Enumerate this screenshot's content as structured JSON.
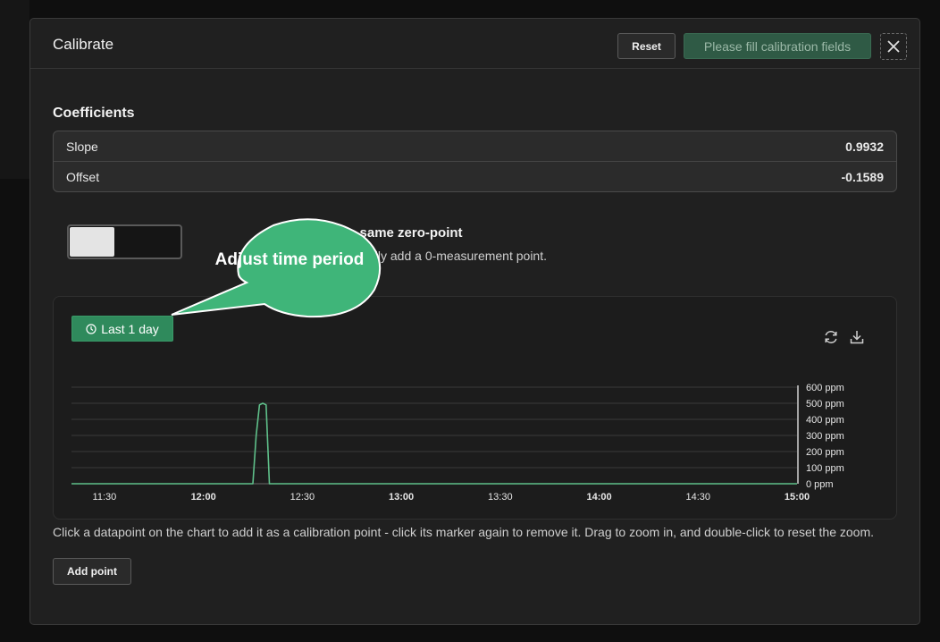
{
  "dialog": {
    "title": "Calibrate",
    "reset_label": "Reset",
    "submit_label": "Please fill calibration fields",
    "close_icon": "close-icon"
  },
  "coefficients": {
    "title": "Coefficients",
    "rows": [
      {
        "label": "Slope",
        "value": "0.9932"
      },
      {
        "label": "Offset",
        "value": "-0.1589"
      }
    ]
  },
  "zero_point": {
    "title": "e same zero-point",
    "description": "ally add a 0-measurement point.",
    "toggle_on": false
  },
  "callout": {
    "text": "Adjust time period",
    "color": "#3fb579"
  },
  "chart_toolbar": {
    "period_label": "Last 1 day",
    "period_icon": "clock-icon",
    "refresh_icon": "refresh-icon",
    "download_icon": "download-icon"
  },
  "chart_data": {
    "type": "line",
    "x": [
      "11:20",
      "12:15",
      "12:16",
      "12:17",
      "12:18",
      "12:19",
      "12:20",
      "15:00"
    ],
    "y": [
      0,
      0,
      300,
      490,
      500,
      490,
      0,
      0
    ],
    "xticks": [
      "11:30",
      "12:00",
      "12:30",
      "13:00",
      "13:30",
      "14:00",
      "14:30",
      "15:00"
    ],
    "bold_xticks": [
      "12:00",
      "13:00",
      "14:00",
      "15:00"
    ],
    "yticks": [
      "600 ppm",
      "500 ppm",
      "400 ppm",
      "300 ppm",
      "200 ppm",
      "100 ppm",
      "0 ppm"
    ],
    "ylim": [
      0,
      600
    ],
    "y_axis_side": "right",
    "grid": true,
    "line_color": "#5fc08a"
  },
  "hint": "Click a datapoint on the chart to add it as a calibration point - click its marker again to remove it. Drag to zoom in, and double-click to reset the zoom.",
  "add_point_label": "Add point"
}
